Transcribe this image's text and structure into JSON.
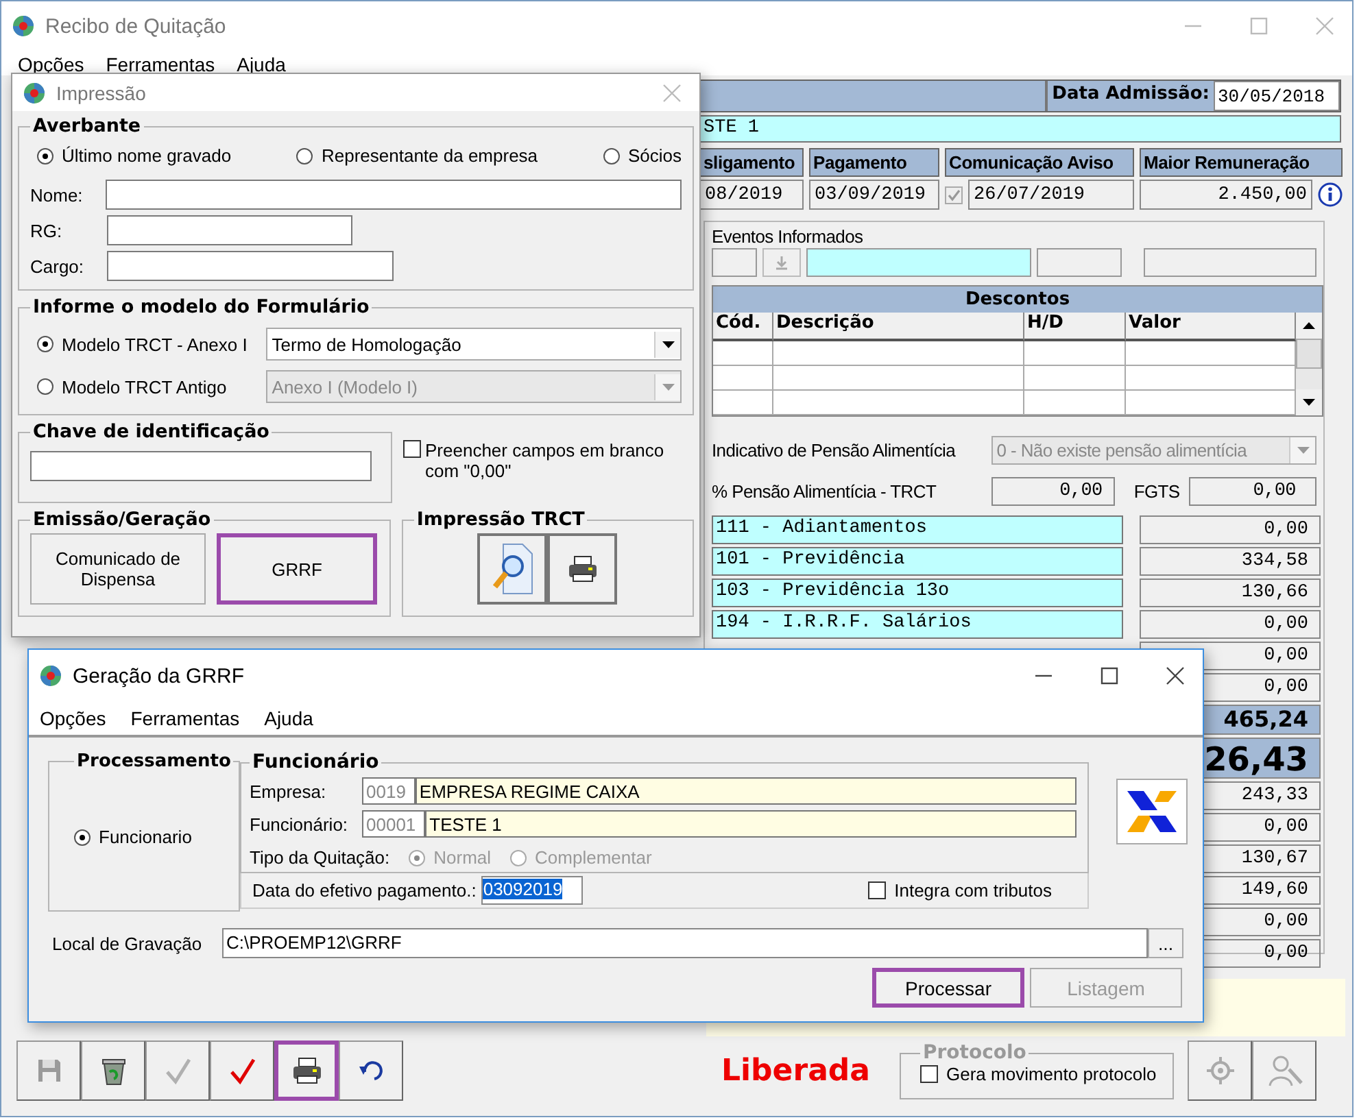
{
  "main_window": {
    "title": "Recibo de Quitação",
    "menu": [
      "Opções",
      "Ferramentas",
      "Ajuda"
    ],
    "admission": {
      "label": "Data Admissão:",
      "value": "30/05/2018"
    },
    "employee_name": "STE 1",
    "dates": [
      {
        "label": "sligamento",
        "value": "08/2019",
        "kind": "plain"
      },
      {
        "label": "Pagamento",
        "value": "03/09/2019",
        "kind": "plain"
      },
      {
        "label": "Comunicação Aviso",
        "value": "26/07/2019",
        "kind": "check",
        "checked": true
      },
      {
        "label": "Maior Remuneração",
        "value": "2.450,00",
        "kind": "info"
      }
    ],
    "eventos": {
      "label": "Eventos Informados"
    },
    "descontos": {
      "title": "Descontos",
      "columns": [
        "Cód.",
        "Descrição",
        "H/D",
        "Valor"
      ]
    },
    "pensao": {
      "label": "Indicativo de Pensão Alimentícia",
      "value": "0 - Não existe pensão alimentícia",
      "disabled": true
    },
    "pensao_pct": {
      "label": "% Pensão Alimentícia - TRCT",
      "value": "0,00"
    },
    "fgts": {
      "label": "FGTS",
      "value": "0,00"
    },
    "totals": [
      {
        "kind": "row",
        "label": "111 - Adiantamentos",
        "value": "0,00"
      },
      {
        "kind": "row",
        "label": "101 - Previdência",
        "value": "334,58"
      },
      {
        "kind": "row",
        "label": "103 - Previdência 13o",
        "value": "130,66"
      },
      {
        "kind": "row",
        "label": "194 - I.R.R.F. Salários",
        "value": "0,00"
      },
      {
        "kind": "value",
        "value": "0,00"
      },
      {
        "kind": "value",
        "value": "0,00"
      },
      {
        "kind": "subtotal",
        "value": "465,24"
      },
      {
        "kind": "total",
        "value": "26,43"
      },
      {
        "kind": "value",
        "value": "243,33"
      },
      {
        "kind": "value",
        "value": "0,00"
      },
      {
        "kind": "value",
        "value": "130,67"
      },
      {
        "kind": "value",
        "value": "149,60"
      },
      {
        "kind": "value",
        "value": "0,00"
      },
      {
        "kind": "value",
        "value": "0,00"
      }
    ],
    "toolbar": [
      {
        "kind": "save",
        "disabled": true,
        "highlighted": false
      },
      {
        "kind": "recycle",
        "disabled": false,
        "highlighted": false
      },
      {
        "kind": "confirm",
        "disabled": true,
        "highlighted": false
      },
      {
        "kind": "confirm",
        "disabled": false,
        "highlighted": false
      },
      {
        "kind": "print",
        "disabled": false,
        "highlighted": true
      },
      {
        "kind": "undo",
        "disabled": false,
        "highlighted": false
      }
    ],
    "status": "Liberada",
    "protocolo": {
      "title": "Protocolo",
      "label": "Gera movimento protocolo",
      "checked": false
    },
    "tools": [
      {
        "kind": "compass",
        "disabled": true
      },
      {
        "kind": "person",
        "disabled": true
      }
    ]
  },
  "impressao": {
    "title": "Impressão",
    "averbante": {
      "title": "Averbante",
      "options": [
        {
          "label": "Último nome gravado",
          "selected": true
        },
        {
          "label": "Representante da empresa",
          "selected": false
        },
        {
          "label": "Sócios",
          "selected": false
        }
      ],
      "fields": [
        {
          "label": "Nome:"
        },
        {
          "label": "RG:"
        },
        {
          "label": "Cargo:"
        }
      ]
    },
    "modelo": {
      "title": "Informe o modelo do Formulário",
      "options": [
        {
          "label": "Modelo TRCT - Anexo I",
          "selected": true,
          "select": "Termo de Homologação",
          "disabled": false
        },
        {
          "label": "Modelo TRCT Antigo",
          "selected": false,
          "select": "Anexo I (Modelo I)",
          "disabled": true
        }
      ]
    },
    "chave": {
      "title": "Chave de identificação"
    },
    "preencher": {
      "label": "Preencher campos em branco com \"0,00\"",
      "checked": false
    },
    "emissao": {
      "title": "Emissão/Geração",
      "buttons": [
        {
          "label": "Comunicado de Dispensa",
          "highlighted": false
        },
        {
          "label": "GRRF",
          "highlighted": true
        }
      ]
    },
    "trct": {
      "title": "Impressão TRCT",
      "buttons": [
        {
          "kind": "preview"
        },
        {
          "kind": "print"
        }
      ]
    }
  },
  "grrf": {
    "title": "Geração da GRRF",
    "menu": [
      "Opções",
      "Ferramentas",
      "Ajuda"
    ],
    "processamento": {
      "title": "Processamento",
      "options": [
        {
          "label": "Funcionario",
          "selected": true
        }
      ]
    },
    "funcionario": {
      "title": "Funcionário",
      "rows": [
        {
          "label": "Empresa:",
          "code": "0019",
          "name": "EMPRESA REGIME CAIXA"
        },
        {
          "label": "Funcionário:",
          "code": "00001",
          "name": "TESTE 1"
        }
      ],
      "tipo": {
        "label": "Tipo da Quitação:",
        "disabled": true,
        "options": [
          {
            "label": "Normal",
            "selected": true
          },
          {
            "label": "Complementar",
            "selected": false
          }
        ]
      }
    },
    "data_pagamento": {
      "label": "Data do efetivo pagamento.:",
      "value": "03092019",
      "text_selected": true
    },
    "integra": {
      "label": "Integra com tributos",
      "checked": false
    },
    "local": {
      "label": "Local de Gravação",
      "value": "C:\\PROEMP12\\GRRF",
      "browse": "..."
    },
    "buttons": [
      {
        "label": "Processar",
        "highlighted": true,
        "disabled": false
      },
      {
        "label": "Listagem",
        "highlighted": false,
        "disabled": true
      }
    ]
  }
}
